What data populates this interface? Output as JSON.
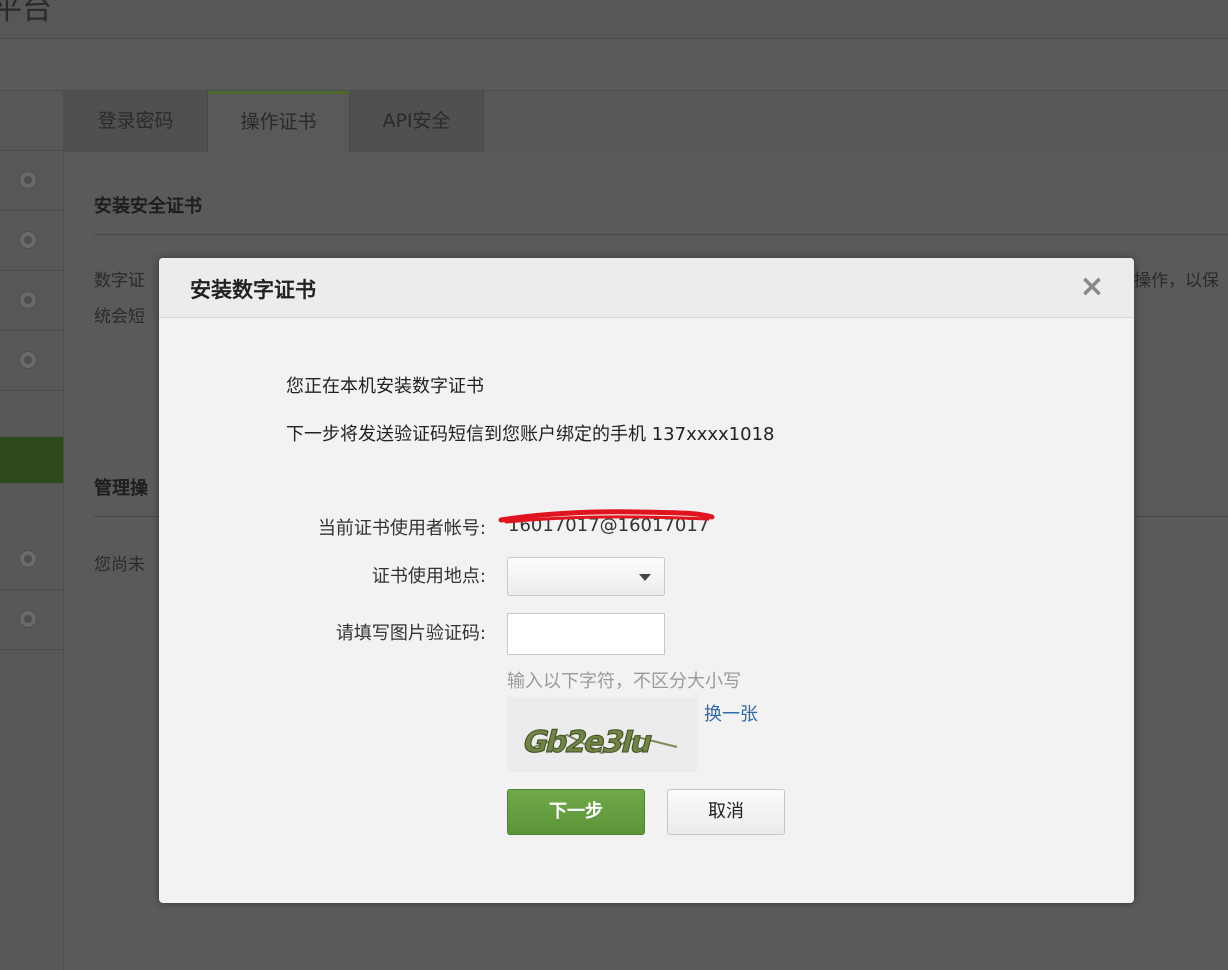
{
  "page": {
    "title_fragment": "平台",
    "tabs": [
      {
        "label": "登录密码"
      },
      {
        "label": "操作证书"
      },
      {
        "label": "API安全"
      }
    ],
    "section1_title": "安装安全证书",
    "section1_text_line1": "数字证",
    "section1_text_line2": "统会短",
    "section1_text_right": "操作，以保",
    "section2_title": "管理操",
    "section2_text": "您尚未"
  },
  "modal": {
    "title": "安装数字证书",
    "close_symbol": "×",
    "message_line1": "您正在本机安装数字证书",
    "message_line2": "下一步将发送验证码短信到您账户绑定的手机 137xxxx1018",
    "account_label": "当前证书使用者帐号:",
    "account_value": "16017017@16017017",
    "location_label": "证书使用地点:",
    "location_value": "",
    "captcha_label": "请填写图片验证码:",
    "captcha_value": "",
    "captcha_hint": "输入以下字符，不区分大小写",
    "captcha_image_text": "Gb2e3Iu",
    "refresh_link": "换一张",
    "next_button": "下一步",
    "cancel_button": "取消"
  },
  "colors": {
    "primary_button": "#5b9538",
    "link": "#2f6aa8",
    "redaction": "#e0141e",
    "active_tab_accent": "#4b6a2c"
  }
}
